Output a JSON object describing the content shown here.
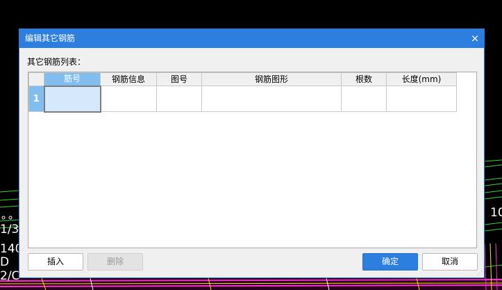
{
  "background": {
    "cad_labels": [
      "10",
      "1/3",
      "140",
      "D",
      "2/C"
    ]
  },
  "dialog": {
    "title": "编辑其它钢筋",
    "close_glyph": "×",
    "list_label": "其它钢筋列表：",
    "table": {
      "columns": [
        "筋号",
        "钢筋信息",
        "图号",
        "钢筋图形",
        "根数",
        "长度(mm)"
      ],
      "rows": [
        {
          "index": "1",
          "cells": [
            "",
            "",
            "",
            "",
            "",
            ""
          ]
        }
      ]
    },
    "buttons": {
      "insert": "插入",
      "delete": "删除",
      "ok": "确定",
      "cancel": "取消"
    },
    "colors": {
      "titlebar": "#2d7fdf",
      "selected_header": "#82bdf0",
      "active_cell": "#d6e8fb",
      "primary_button": "#2d7fdf"
    }
  }
}
